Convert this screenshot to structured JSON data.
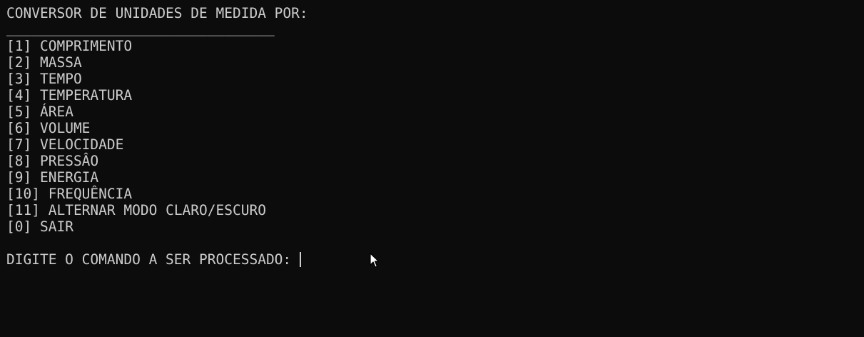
{
  "terminal": {
    "title": "CONVERSOR DE UNIDADES DE MEDIDA POR:",
    "divider": "________________________________",
    "menu": [
      {
        "key": "[1]",
        "label": "COMPRIMENTO"
      },
      {
        "key": "[2]",
        "label": "MASSA"
      },
      {
        "key": "[3]",
        "label": "TEMPO"
      },
      {
        "key": "[4]",
        "label": "TEMPERATURA"
      },
      {
        "key": "[5]",
        "label": "ÁREA"
      },
      {
        "key": "[6]",
        "label": "VOLUME"
      },
      {
        "key": "[7]",
        "label": "VELOCIDADE"
      },
      {
        "key": "[8]",
        "label": "PRESSÂO"
      },
      {
        "key": "[9]",
        "label": "ENERGIA"
      },
      {
        "key": "[10]",
        "label": "FREQUÊNCIA"
      },
      {
        "key": "[11]",
        "label": "ALTERNAR MODO CLARO/ESCURO"
      },
      {
        "key": "[0]",
        "label": "SAIR"
      }
    ],
    "prompt": "DIGITE O COMANDO A SER PROCESSADO: ",
    "input_value": ""
  },
  "colors": {
    "background": "#0c0c0c",
    "foreground": "#cccccc"
  },
  "icons": {
    "mouse_pointer": "arrow-pointer-icon"
  }
}
